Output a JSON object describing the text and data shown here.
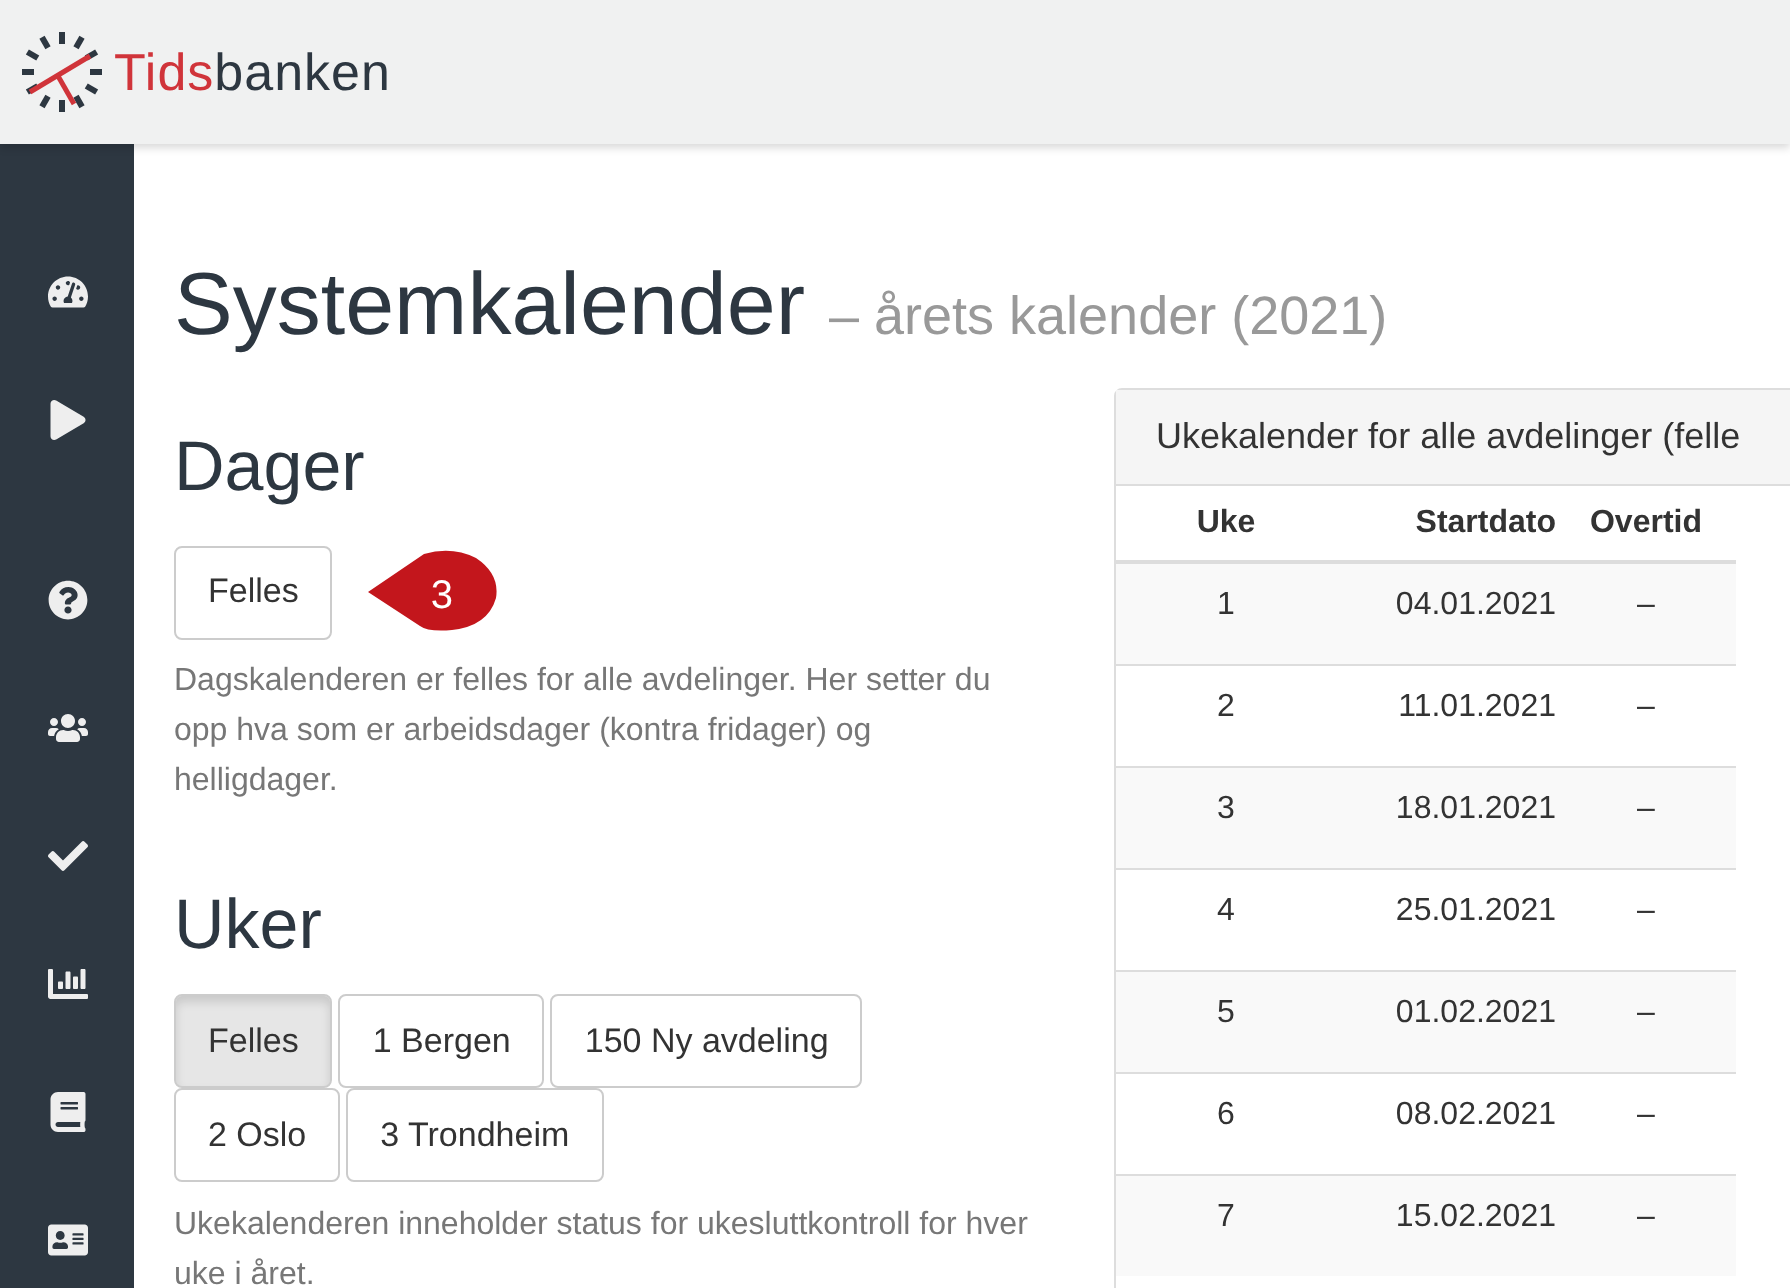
{
  "logo": {
    "text_parts": [
      {
        "text": "Tids",
        "color": "#d0343a"
      },
      {
        "text": "banken",
        "color": "#2d3741"
      }
    ]
  },
  "page": {
    "title": "Systemkalender",
    "subtitle": "– årets kalender (2021)"
  },
  "days": {
    "heading": "Dager",
    "buttons": [
      {
        "label": "Felles",
        "selected": false
      }
    ],
    "callout": "3",
    "description": "Dagskalenderen er felles for alle avdelinger. Her setter du opp hva som er arbeidsdager (kontra fridager) og helligdager."
  },
  "weeks": {
    "heading": "Uker",
    "buttons": [
      {
        "label": "Felles",
        "selected": true
      },
      {
        "label": "1 Bergen",
        "selected": false
      },
      {
        "label": "150 Ny avdeling",
        "selected": false
      },
      {
        "label": "2 Oslo",
        "selected": false
      },
      {
        "label": "3 Trondheim",
        "selected": false
      }
    ],
    "description": "Ukekalenderen inneholder status for ukesluttkontroll for hver uke i året."
  },
  "week_panel": {
    "title": "Ukekalender for alle avdelinger (felle",
    "columns": [
      "Uke",
      "Startdato",
      "Overtid"
    ],
    "rows": [
      [
        "1",
        "04.01.2021",
        "–"
      ],
      [
        "2",
        "11.01.2021",
        "–"
      ],
      [
        "3",
        "18.01.2021",
        "–"
      ],
      [
        "4",
        "25.01.2021",
        "–"
      ],
      [
        "5",
        "01.02.2021",
        "–"
      ],
      [
        "6",
        "08.02.2021",
        "–"
      ],
      [
        "7",
        "15.02.2021",
        "–"
      ]
    ]
  }
}
